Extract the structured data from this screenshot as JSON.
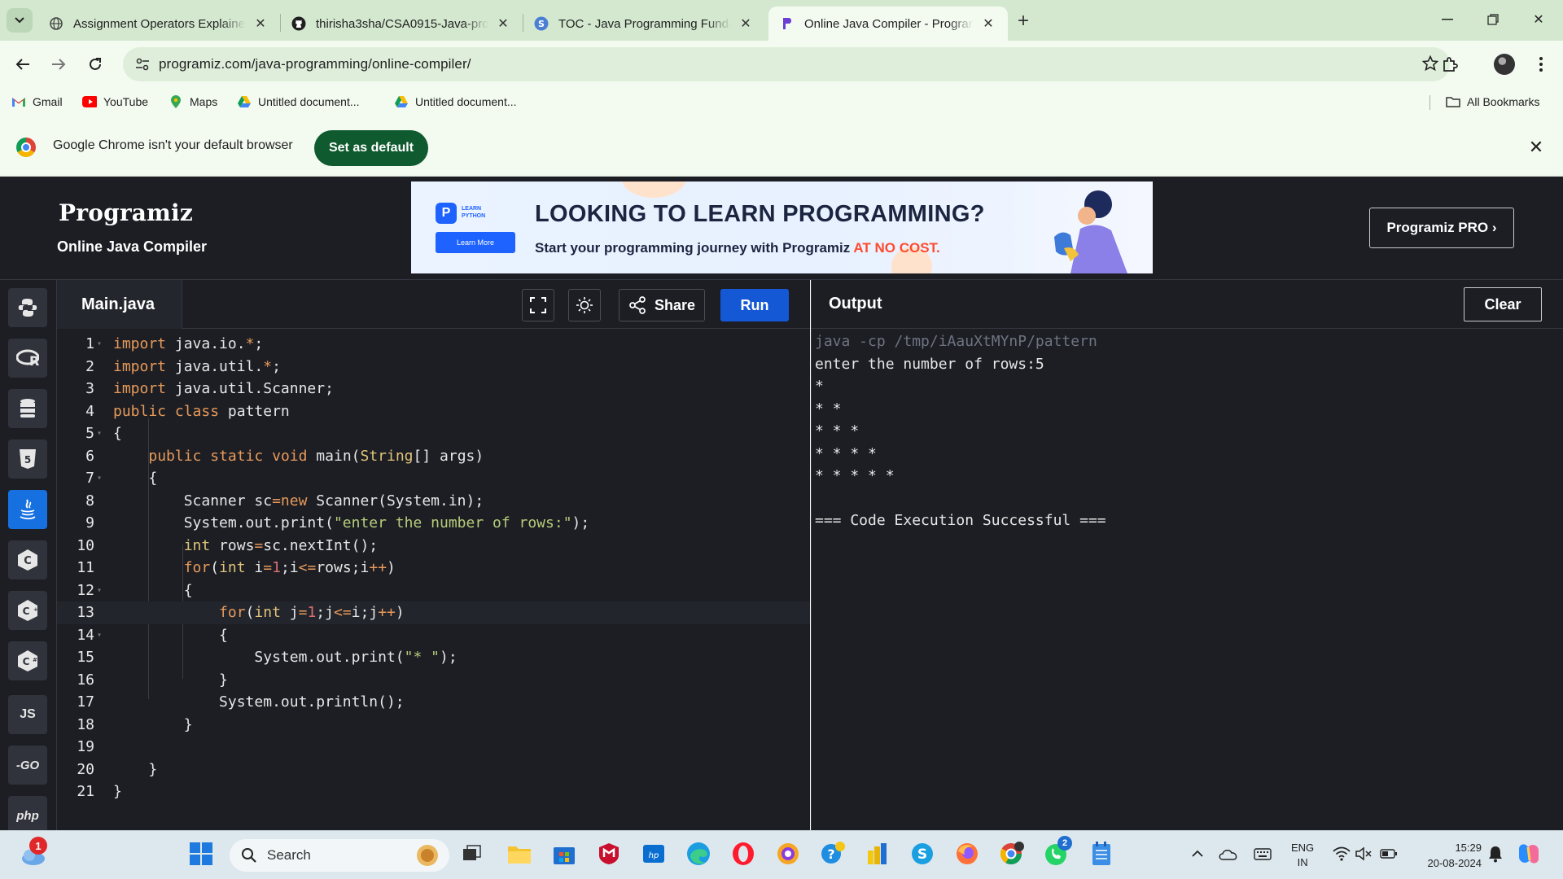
{
  "browser": {
    "tabs": [
      {
        "title": "Assignment Operators Explaine",
        "active": false
      },
      {
        "title": "thirisha3sha/CSA0915-Java-pro",
        "active": false
      },
      {
        "title": "TOC - Java Programming Funda",
        "active": false
      },
      {
        "title": "Online Java Compiler - Program",
        "active": true
      }
    ],
    "url": "programiz.com/java-programming/online-compiler/",
    "bookmarks": [
      {
        "label": "Gmail",
        "icon": "gmail-icon"
      },
      {
        "label": "YouTube",
        "icon": "youtube-icon"
      },
      {
        "label": "Maps",
        "icon": "maps-icon"
      },
      {
        "label": "Untitled document...",
        "icon": "drive-icon"
      },
      {
        "label": "Untitled document...",
        "icon": "drive-icon"
      }
    ],
    "all_bookmarks": "All Bookmarks",
    "infobar": {
      "message": "Google Chrome isn't your default browser",
      "button": "Set as default"
    }
  },
  "site": {
    "logo": "Programiz",
    "subtitle": "Online Java Compiler",
    "banner": {
      "badge_line1": "LEARN",
      "badge_line2": "PYTHON",
      "badge_button": "Learn More",
      "headline": "LOOKING TO LEARN PROGRAMMING?",
      "tagline_prefix": "Start your programming journey with Programiz ",
      "tagline_highlight": "AT NO COST."
    },
    "pro_button": "Programiz PRO ›"
  },
  "languages": [
    {
      "name": "python-icon",
      "label": ""
    },
    {
      "name": "r-icon",
      "label": ""
    },
    {
      "name": "sql-icon",
      "label": ""
    },
    {
      "name": "html-icon",
      "label": ""
    },
    {
      "name": "java-icon",
      "label": "",
      "active": true
    },
    {
      "name": "c-icon",
      "label": ""
    },
    {
      "name": "cpp-icon",
      "label": ""
    },
    {
      "name": "csharp-icon",
      "label": ""
    },
    {
      "name": "js-icon",
      "label": "JS"
    },
    {
      "name": "go-icon",
      "label": "-GO"
    },
    {
      "name": "php-icon",
      "label": "php"
    }
  ],
  "editor": {
    "file_name": "Main.java",
    "share_label": "Share",
    "run_label": "Run",
    "lines": [
      "import java.io.*;",
      "import java.util.*;",
      "import java.util.Scanner;",
      "public class pattern",
      "{",
      "    public static void main(String[] args)",
      "    {",
      "        Scanner sc=new Scanner(System.in);",
      "        System.out.print(\"enter the number of rows:\");",
      "        int rows=sc.nextInt();",
      "        for(int i=1;i<=rows;i++)",
      "        {",
      "            for(int j=1;j<=i;j++)",
      "            {",
      "                System.out.print(\"* \");",
      "            }",
      "            System.out.println();",
      "        }",
      "",
      "    }",
      "}"
    ]
  },
  "output": {
    "title": "Output",
    "clear_label": "Clear",
    "lines": [
      "java -cp /tmp/iAauXtMYnP/pattern",
      "enter the number of rows:5",
      "*",
      "* *",
      "* * *",
      "* * * *",
      "* * * * *",
      "",
      "=== Code Execution Successful ==="
    ]
  },
  "taskbar": {
    "search_placeholder": "Search",
    "notification_badge": "1",
    "whatsapp_badge": "2",
    "lang_line1": "ENG",
    "lang_line2": "IN",
    "time": "15:29",
    "date": "20-08-2024"
  }
}
